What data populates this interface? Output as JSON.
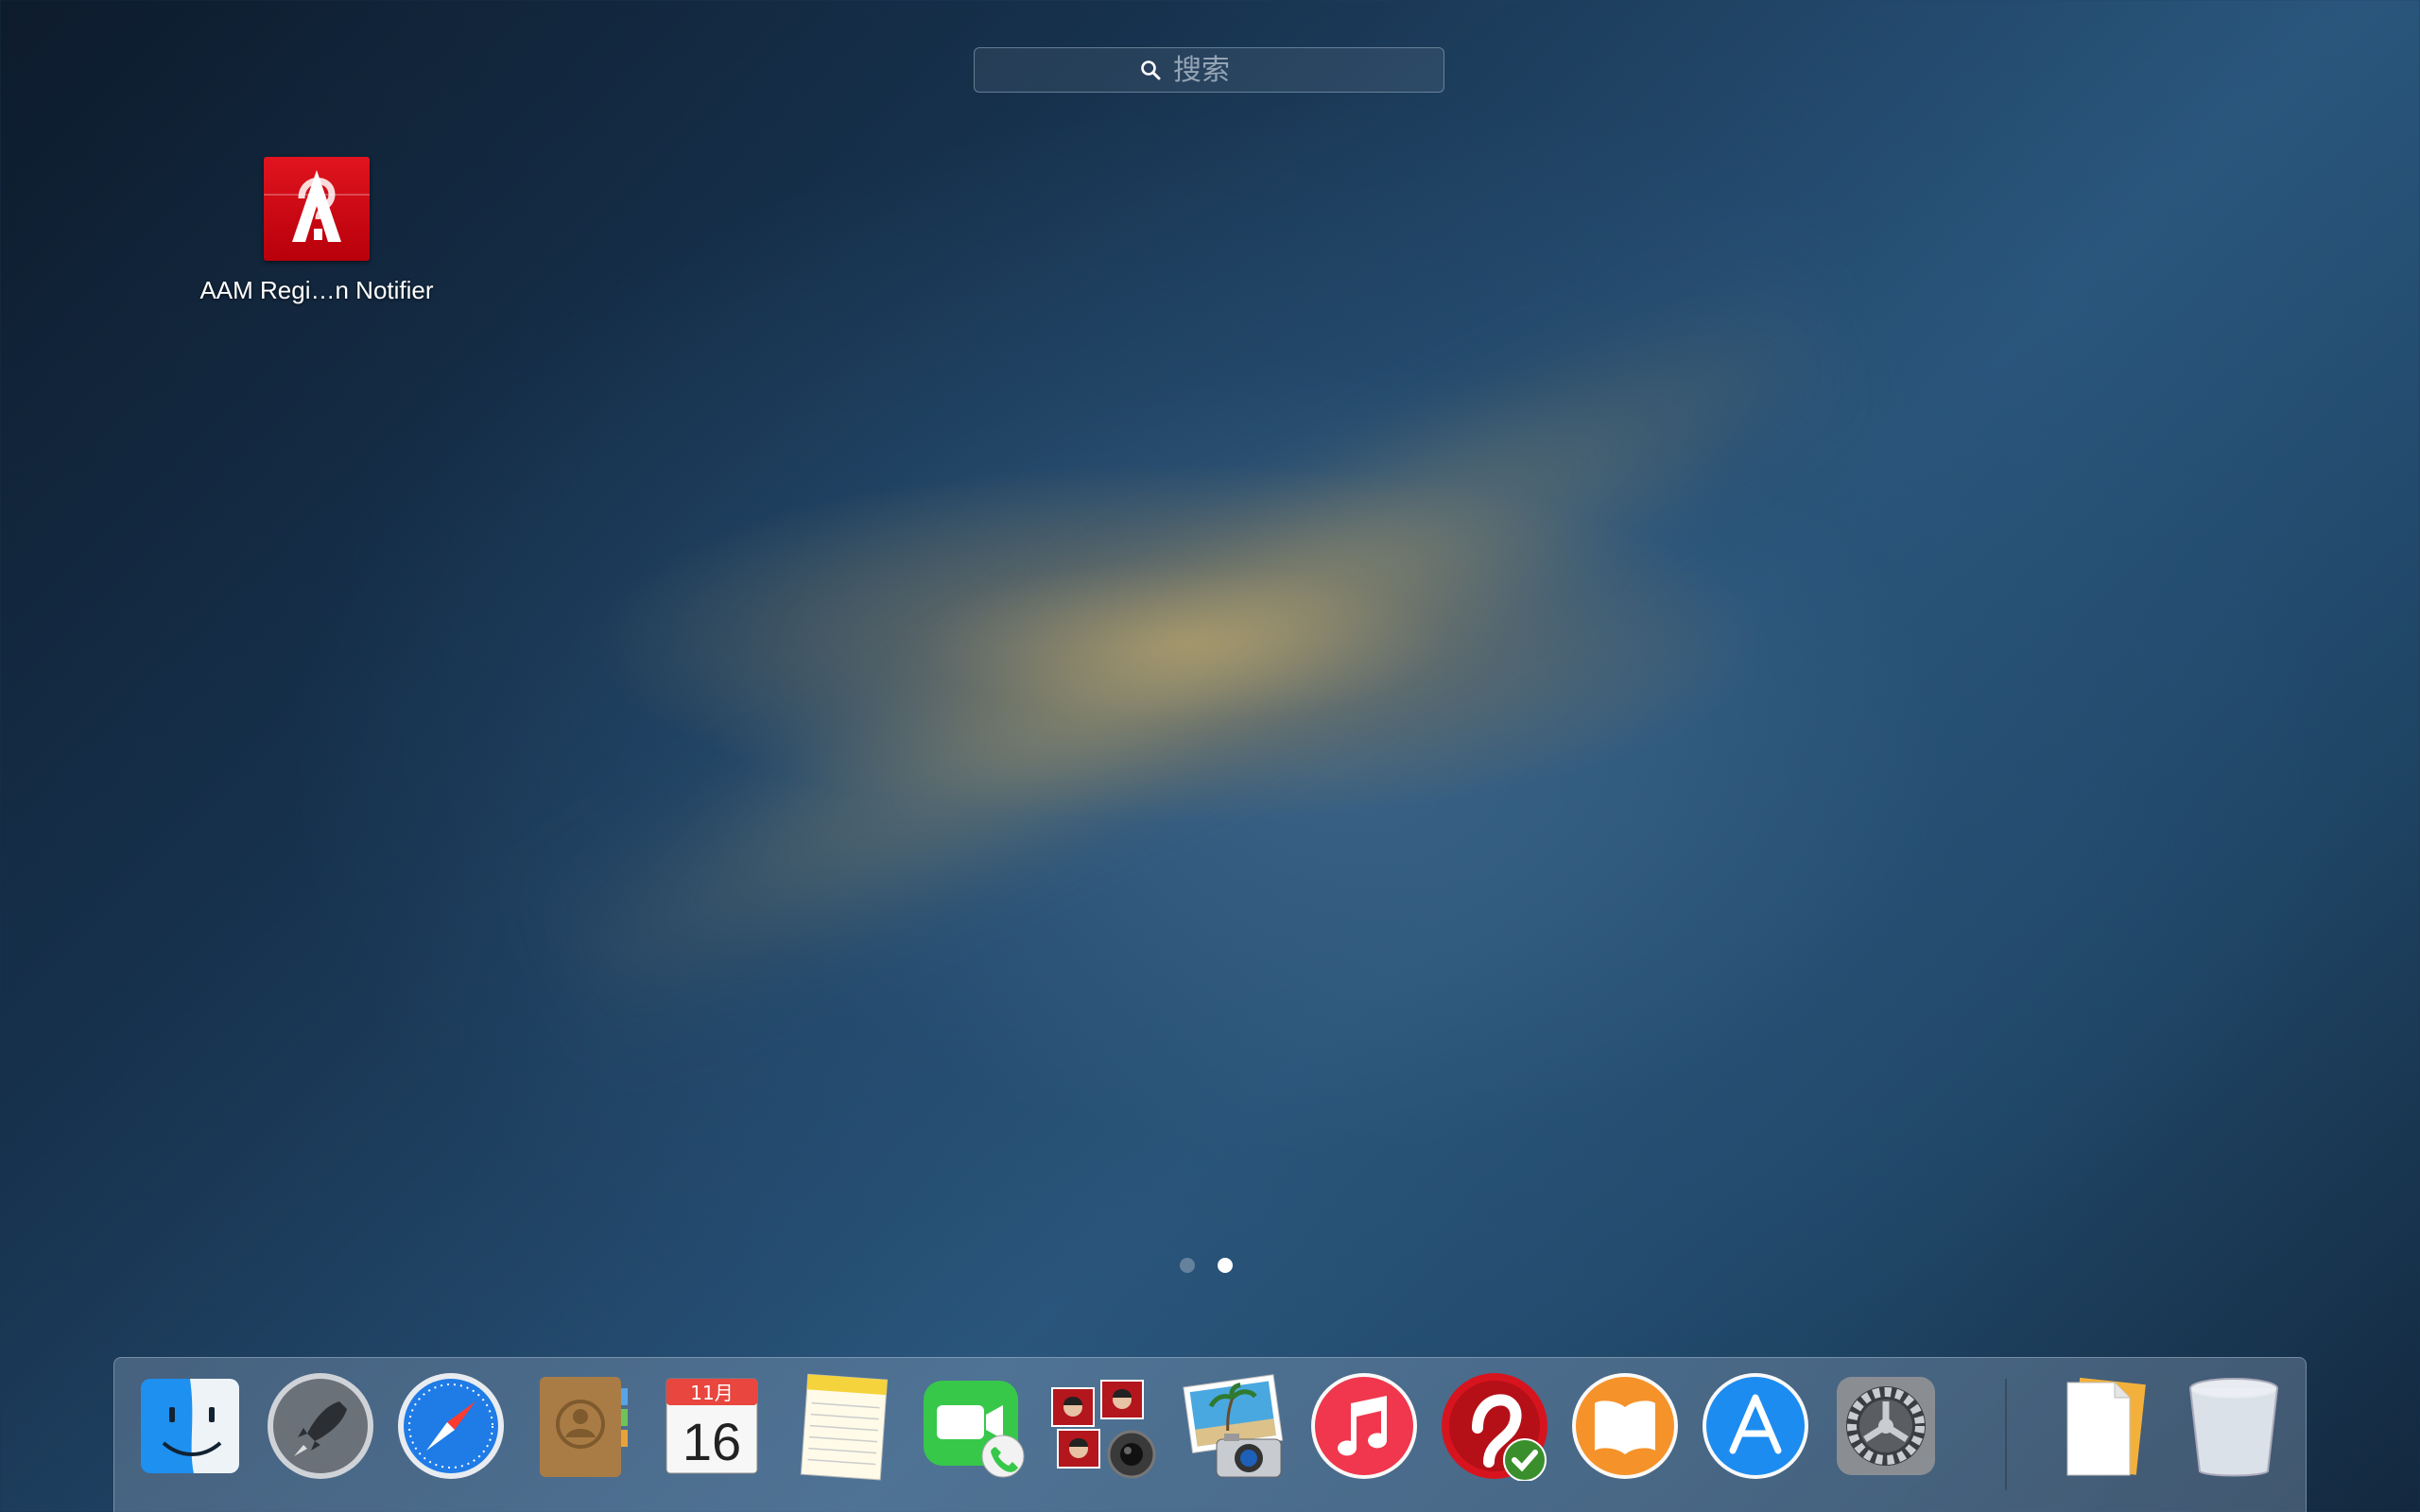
{
  "search": {
    "placeholder": "搜索"
  },
  "desktop_app": {
    "label": "AAM Regi…n Notifier",
    "icon": "adobe-notifier-icon"
  },
  "pagination": {
    "pages": 2,
    "current": 2
  },
  "calendar": {
    "month": "11月",
    "day": "16"
  },
  "dock": {
    "items": [
      {
        "name": "finder",
        "icon": "finder-icon",
        "running": true
      },
      {
        "name": "launchpad",
        "icon": "rocket-icon",
        "running": false
      },
      {
        "name": "safari",
        "icon": "compass-icon",
        "running": true
      },
      {
        "name": "contacts",
        "icon": "contacts-book-icon",
        "running": false
      },
      {
        "name": "calendar",
        "icon": "calendar-icon",
        "running": false
      },
      {
        "name": "notes",
        "icon": "notepad-icon",
        "running": false
      },
      {
        "name": "facetime",
        "icon": "video-camera-icon",
        "running": false
      },
      {
        "name": "photo-booth",
        "icon": "photo-booth-icon",
        "running": false
      },
      {
        "name": "iphoto",
        "icon": "photo-camera-icon",
        "running": false
      },
      {
        "name": "itunes",
        "icon": "music-note-icon",
        "running": false
      },
      {
        "name": "adobe-app",
        "icon": "adobe-check-icon",
        "running": true
      },
      {
        "name": "ibooks",
        "icon": "open-book-icon",
        "running": false
      },
      {
        "name": "app-store",
        "icon": "app-store-icon",
        "running": false
      },
      {
        "name": "system-preferences",
        "icon": "gear-icon",
        "running": false
      },
      {
        "name": "documents",
        "icon": "document-stack-icon",
        "running": false
      },
      {
        "name": "trash",
        "icon": "trash-icon",
        "running": false
      }
    ]
  },
  "colors": {
    "accent": "#2a567d",
    "adobe_red": "#d7141e"
  }
}
